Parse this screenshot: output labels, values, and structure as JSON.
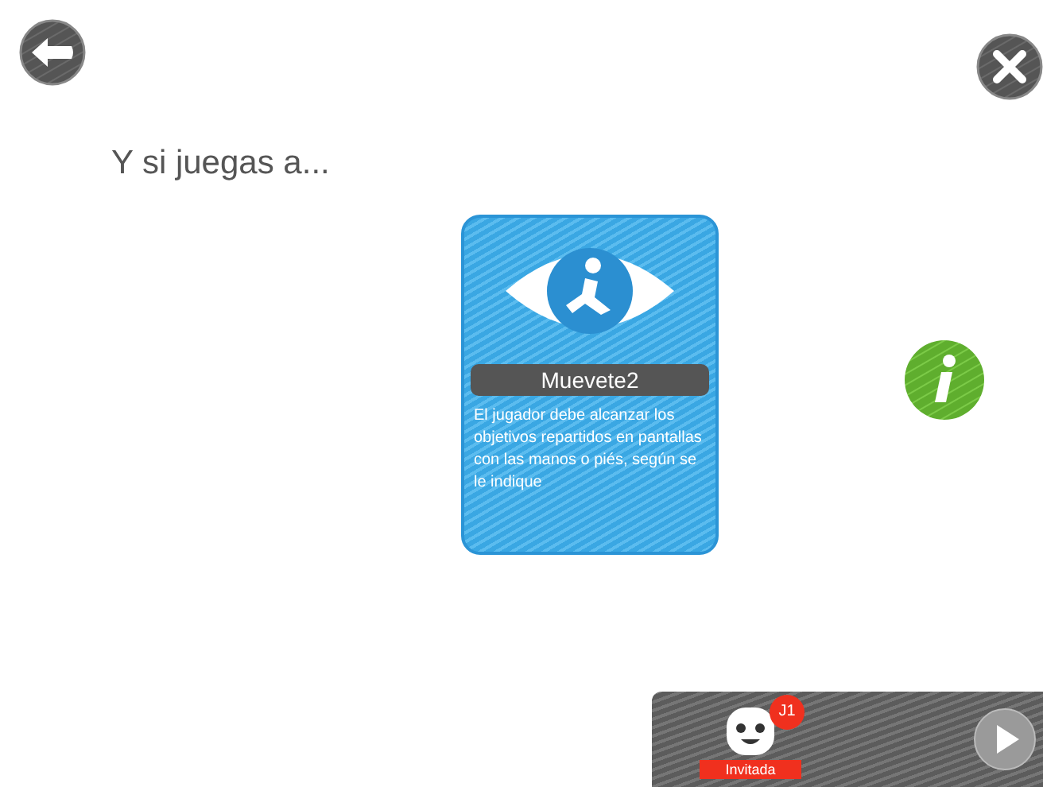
{
  "heading": "Y si juegas a...",
  "game_card": {
    "name": "Muevete2",
    "description": "El jugador debe alcanzar los objetivos repartidos en pantallas con las manos o piés, según se le indique"
  },
  "player": {
    "badge": "J1",
    "status": "Invitada"
  }
}
